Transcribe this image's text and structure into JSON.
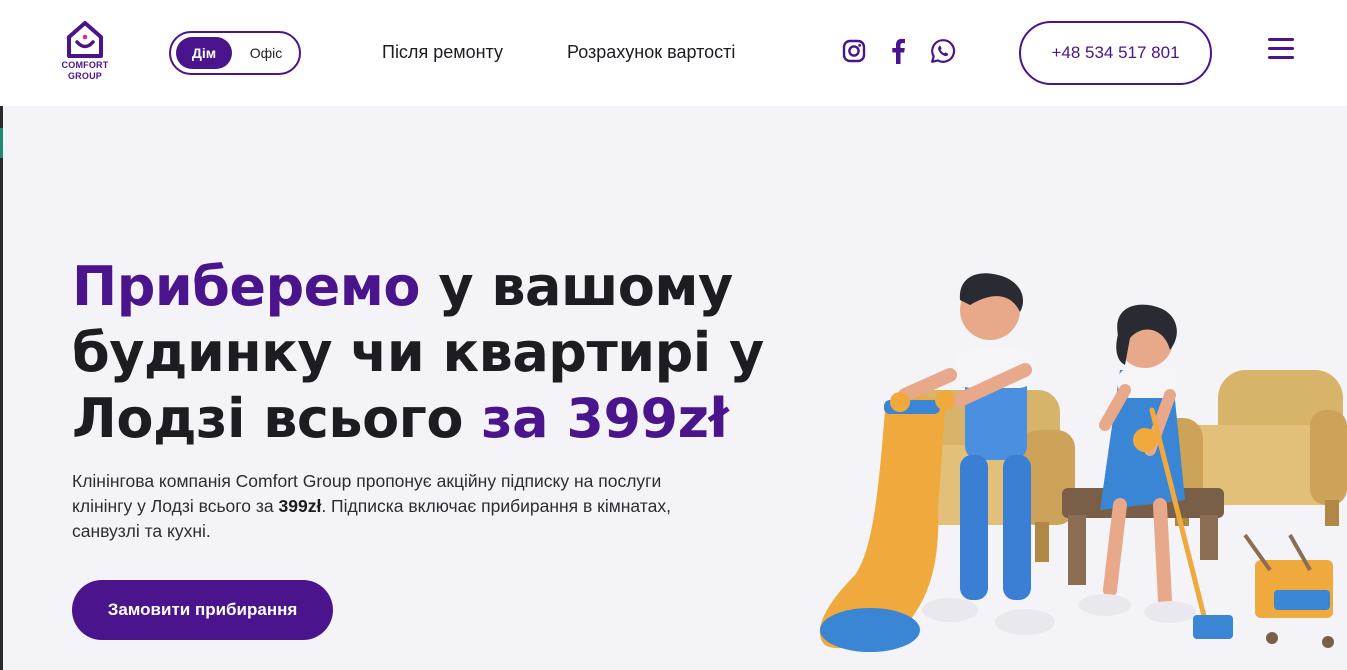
{
  "logo": {
    "line1": "COMFORT",
    "line2": "GROUP"
  },
  "toggle": {
    "active": "Дім",
    "inactive": "Офіс"
  },
  "nav": {
    "after_repair": "Після ремонту",
    "cost_calc": "Розрахунок вартості"
  },
  "social": [
    "instagram-icon",
    "facebook-icon",
    "whatsapp-icon"
  ],
  "phone": "+48 534 517 801",
  "hero": {
    "title_part1": "Приберемо",
    "title_part2": " у вашому будинку чи квартирі у Лодзі всього ",
    "title_part3": "за 399zł",
    "desc_part1": "Клінінгова компанія Comfort Group пропонує акційну підписку на послуги клінінгу у Лодзі всього за ",
    "desc_bold": "399zł",
    "desc_part2": ". Підписка включає прибирання в кімнатах, санвузлі та кухні.",
    "cta": "Замовити прибирання"
  },
  "colors": {
    "brand": "#4a148c",
    "background": "#f4f3f7",
    "text": "#1c1c22"
  }
}
